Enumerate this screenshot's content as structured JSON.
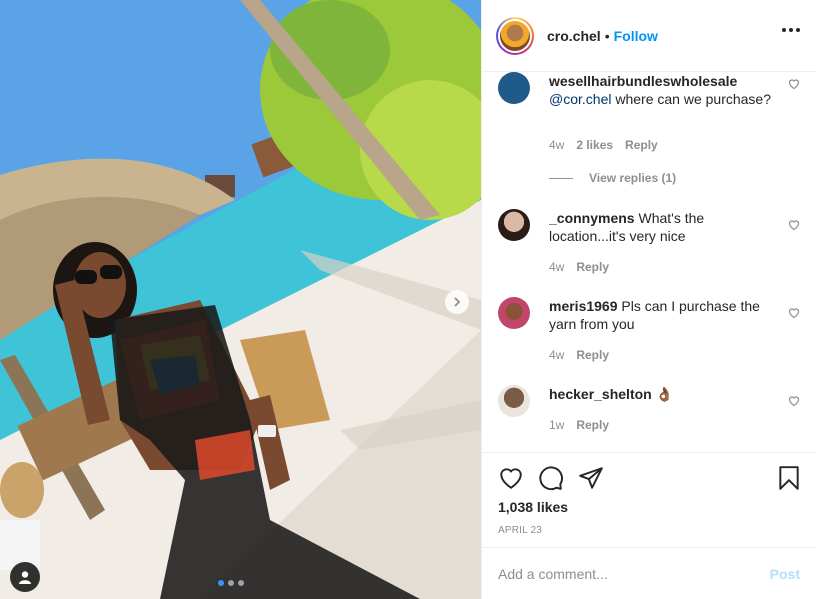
{
  "post": {
    "username": "cro.chel",
    "separator": "•",
    "follow_label": "Follow",
    "likes_text": "1,038 likes",
    "date": "APRIL 23",
    "carousel_count": 3,
    "carousel_active": 1
  },
  "comments": [
    {
      "username": "wesellhairbundleswholesale",
      "mention": "@cor.chel",
      "text": " where can we purchase?",
      "age": "4w",
      "likes": "2 likes",
      "reply_label": "Reply",
      "avatar_color": "#1f5a8a"
    },
    {
      "username": "_connymens",
      "text": " What's the location...it's very nice",
      "age": "4w",
      "reply_label": "Reply",
      "avatar_color": "#9a7a6a"
    },
    {
      "username": "meris1969",
      "text": " Pls can I purchase the yarn from you",
      "age": "4w",
      "reply_label": "Reply",
      "avatar_color": "#c2466a"
    },
    {
      "username": "hecker_shelton",
      "text": " 👌🏾",
      "age": "1w",
      "reply_label": "Reply",
      "avatar_color": "#7a5b45"
    }
  ],
  "view_replies_label": "View replies (1)",
  "add_comment": {
    "placeholder": "Add a comment...",
    "post_label": "Post"
  },
  "colors": {
    "accent": "#0095f6",
    "post_disabled": "#b2dffc",
    "muted": "#8e8e8e"
  },
  "icons": {
    "more": "more-options-icon",
    "like": "heart-icon",
    "comment": "comment-icon",
    "share": "paper-plane-icon",
    "save": "bookmark-icon",
    "next": "chevron-right-icon",
    "tag": "user-tag-icon"
  }
}
